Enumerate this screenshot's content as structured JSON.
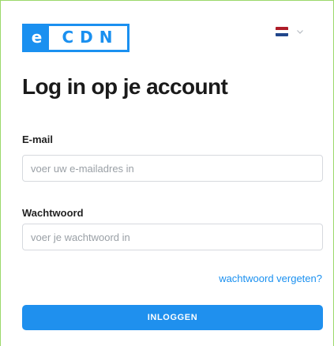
{
  "brand": {
    "logo_e": "e",
    "logo_text": "CDN",
    "color": "#1a90f0"
  },
  "language": {
    "selected": "Nederlands",
    "flag_icon": "flag-nl-icon",
    "chevron_icon": "chevron-down-icon"
  },
  "page": {
    "title": "Log in op je account"
  },
  "form": {
    "email_label": "E-mail",
    "email_placeholder": "voer uw e-mailadres in",
    "email_value": "",
    "password_label": "Wachtwoord",
    "password_placeholder": "voer je wachtwoord in",
    "password_value": "",
    "forgot_label": "wachtwoord vergeten?",
    "submit_label": "INLOGGEN"
  },
  "colors": {
    "accent": "#1f90ee",
    "input_border": "#d6d9de",
    "frame_border": "#9bd86a"
  }
}
